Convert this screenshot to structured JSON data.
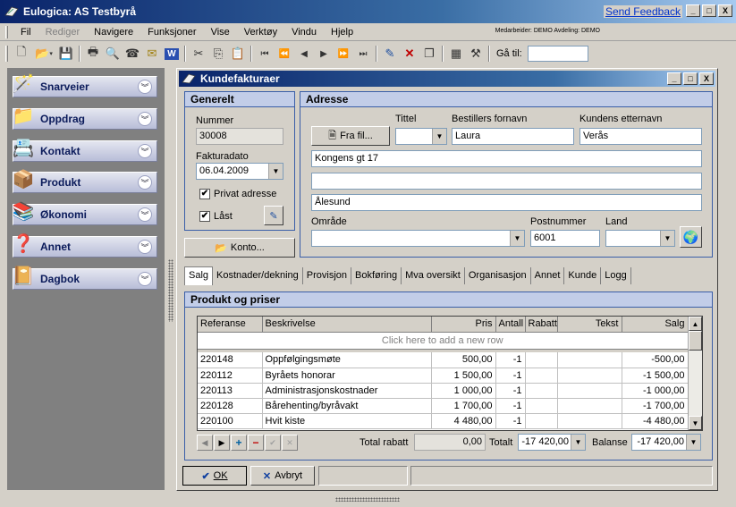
{
  "app": {
    "title": "Eulogica: AS Testbyrå",
    "feedback_link": "Send Feedback",
    "window_buttons": [
      "_",
      "□",
      "X"
    ]
  },
  "menu": {
    "items": [
      "Fil",
      "Rediger",
      "Navigere",
      "Funksjoner",
      "Vise",
      "Verktøy",
      "Vindu",
      "Hjelp"
    ],
    "user_info": "Medarbeider: DEMO   Avdeling: DEMO"
  },
  "toolbar": {
    "icons": [
      "new-document-icon",
      "open-folder-icon",
      "save-icon",
      "print-icon",
      "print-preview-icon",
      "fax-icon",
      "email-icon",
      "word-icon",
      "cut-icon",
      "copy-icon",
      "paste-icon",
      "first-record-icon",
      "previous-page-icon",
      "previous-record-icon",
      "next-record-icon",
      "next-page-icon",
      "last-record-icon",
      "edit-icon",
      "delete-icon",
      "copy-record-icon",
      "calculator-icon",
      "tools-icon"
    ],
    "goto_label": "Gå til:",
    "goto_value": ""
  },
  "sidebar": {
    "items": [
      {
        "label": "Snarveier",
        "icon": "wand-icon"
      },
      {
        "label": "Oppdrag",
        "icon": "folder-icon"
      },
      {
        "label": "Kontakt",
        "icon": "contacts-icon"
      },
      {
        "label": "Produkt",
        "icon": "box-icon"
      },
      {
        "label": "Økonomi",
        "icon": "ledger-icon"
      },
      {
        "label": "Annet",
        "icon": "help-folder-icon"
      },
      {
        "label": "Dagbok",
        "icon": "diary-icon"
      }
    ]
  },
  "child": {
    "title": "Kundefakturaer",
    "generelt": {
      "header": "Generelt",
      "nummer_label": "Nummer",
      "nummer": "30008",
      "fakturadato_label": "Fakturadato",
      "fakturadato": "06.04.2009",
      "privat_adresse": "Privat adresse",
      "privat_checked": "✔",
      "laast": "Låst",
      "laast_checked": "✔"
    },
    "konto_button": "Konto...",
    "adresse": {
      "header": "Adresse",
      "fra_fil": "Fra fil...",
      "tittel_label": "Tittel",
      "tittel": "",
      "fornavn_label": "Bestillers fornavn",
      "fornavn": "Laura",
      "etternavn_label": "Kundens etternavn",
      "etternavn": "Verås",
      "line1": "Kongens gt 17",
      "line2": "",
      "line3": "Ålesund",
      "omraade_label": "Område",
      "omraade": "",
      "postnummer_label": "Postnummer",
      "postnummer": "6001",
      "land_label": "Land",
      "land": ""
    },
    "tabs": [
      "Salg",
      "Kostnader/dekning",
      "Provisjon",
      "Bokføring",
      "Mva oversikt",
      "Organisasjon",
      "Annet",
      "Kunde",
      "Logg"
    ],
    "produkt": {
      "header": "Produkt og priser",
      "columns": [
        "Referanse",
        "Beskrivelse",
        "Pris",
        "Antall",
        "Rabatt",
        "Tekst",
        "Salg"
      ],
      "add_row": "Click here to add a new row",
      "rows": [
        {
          "ref": "220148",
          "desc": "Oppfølgingsmøte",
          "pris": "500,00",
          "antall": "-1",
          "rabatt": "",
          "tekst": "",
          "salg": "-500,00"
        },
        {
          "ref": "220112",
          "desc": "Byråets honorar",
          "pris": "1 500,00",
          "antall": "-1",
          "rabatt": "",
          "tekst": "",
          "salg": "-1 500,00"
        },
        {
          "ref": "220113",
          "desc": "Administrasjonskostnader",
          "pris": "1 000,00",
          "antall": "-1",
          "rabatt": "",
          "tekst": "",
          "salg": "-1 000,00"
        },
        {
          "ref": "220128",
          "desc": "Bårehenting/byråvakt",
          "pris": "1 700,00",
          "antall": "-1",
          "rabatt": "",
          "tekst": "",
          "salg": "-1 700,00"
        },
        {
          "ref": "220100",
          "desc": "Hvit kiste",
          "pris": "4 480,00",
          "antall": "-1",
          "rabatt": "",
          "tekst": "",
          "salg": "-4 480,00"
        }
      ],
      "total_rabatt_label": "Total rabatt",
      "total_rabatt": "0,00",
      "totalt_label": "Totalt",
      "totalt": "-17 420,00",
      "balanse_label": "Balanse",
      "balanse": "-17 420,00"
    },
    "ok_button": "OK",
    "avbryt_button": "Avbryt"
  }
}
